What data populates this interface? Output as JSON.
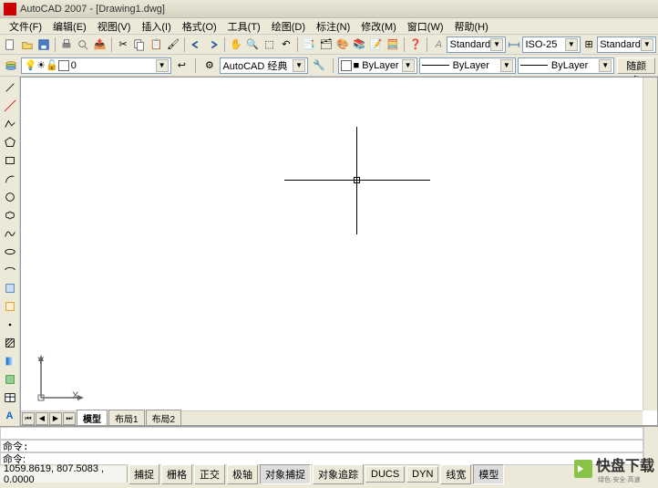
{
  "title": "AutoCAD 2007 - [Drawing1.dwg]",
  "menu": [
    "文件(F)",
    "编辑(E)",
    "视图(V)",
    "插入(I)",
    "格式(O)",
    "工具(T)",
    "绘图(D)",
    "标注(N)",
    "修改(M)",
    "窗口(W)",
    "帮助(H)"
  ],
  "layer_combo": "0",
  "workspace_combo": "AutoCAD 经典",
  "color_combo": "■ ByLayer",
  "linetype_combo": "ByLayer",
  "lineweight_combo": "ByLayer",
  "bycolor_btn": "随颜色",
  "text_style_combo": "Standard",
  "dim_style_combo": "ISO-25",
  "table_style_combo": "Standard",
  "tabs": {
    "model": "模型",
    "layout1": "布局1",
    "layout2": "布局2"
  },
  "cmd_prompt": "命令:",
  "cmd_history": "命令:",
  "coords": "1059.8619, 807.5083 , 0.0000",
  "status": {
    "snap": "捕捉",
    "grid": "栅格",
    "ortho": "正交",
    "polar": "极轴",
    "osnap": "对象捕捉",
    "otrack": "对象追踪",
    "ducs": "DUCS",
    "dyn": "DYN",
    "lwt": "线宽",
    "model": "模型"
  },
  "ucs": {
    "x": "X",
    "y": "Y"
  },
  "watermark": {
    "text": "快盘下载",
    "sub": "绿色·安全·高速"
  },
  "left_tools": [
    "line",
    "construction-line",
    "polyline",
    "polygon",
    "rectangle",
    "arc",
    "circle",
    "revision-cloud",
    "spline",
    "ellipse",
    "ellipse-arc",
    "insert-block",
    "make-block",
    "point",
    "hatch",
    "gradient",
    "region",
    "table",
    "text"
  ]
}
